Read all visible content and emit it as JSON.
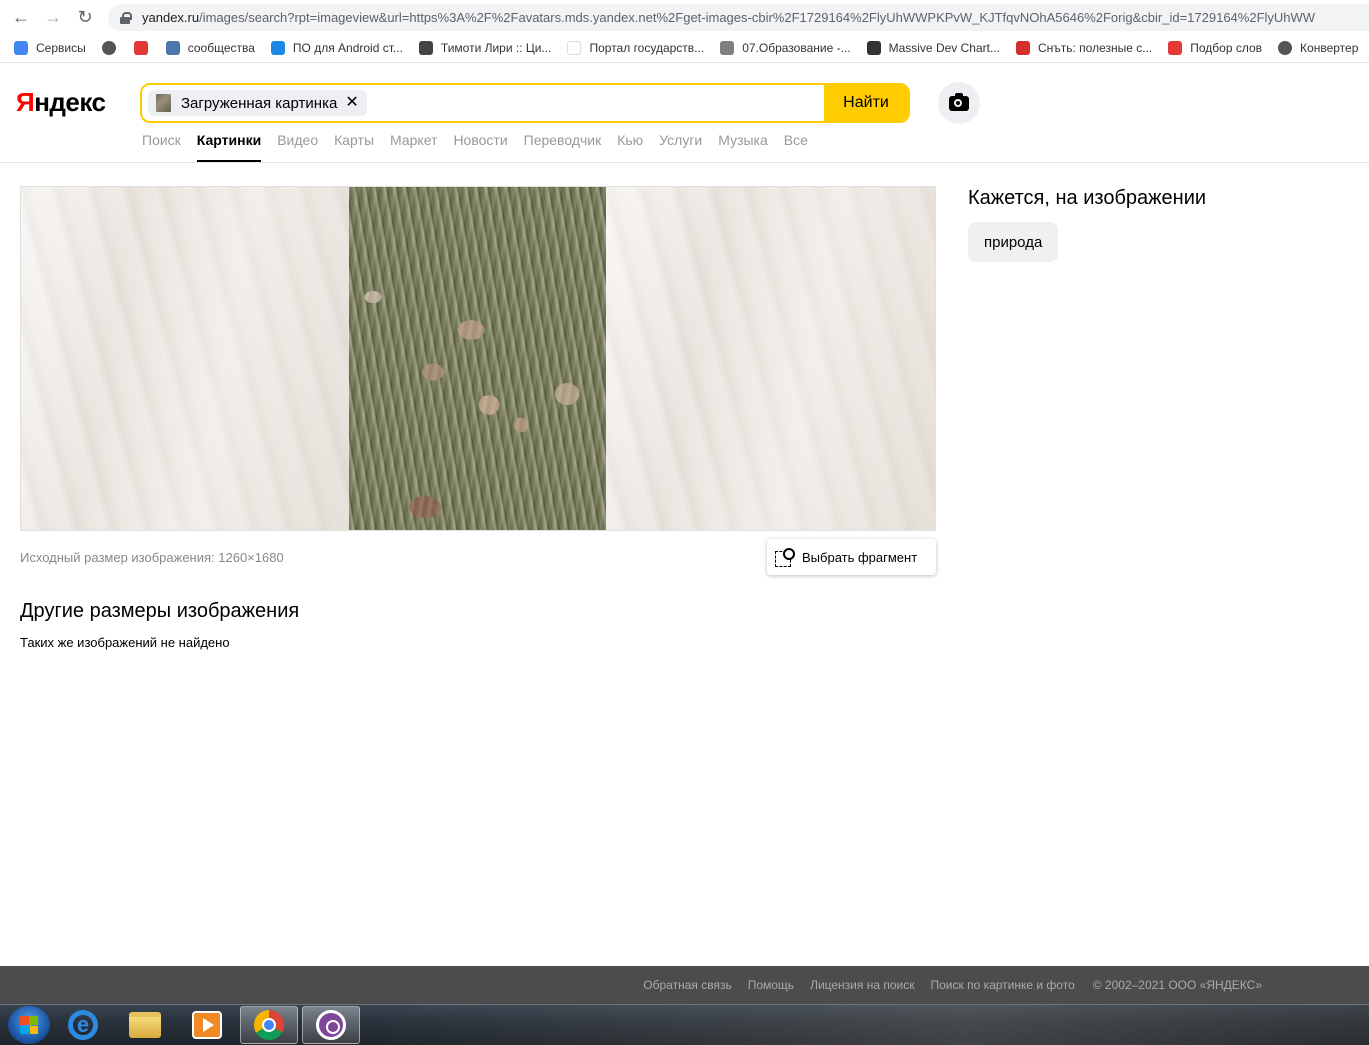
{
  "browser": {
    "url_host": "yandex.ru",
    "url_rest": "/images/search?rpt=imageview&url=https%3A%2F%2Favatars.mds.yandex.net%2Fget-images-cbir%2F1729164%2FlyUhWWPKPvW_KJTfqvNOhA5646%2Forig&cbir_id=1729164%2FlyUhWW",
    "bookmarks": [
      {
        "label": "Сервисы",
        "icon": "apps-grid-icon",
        "color": "#4285f4"
      },
      {
        "label": "",
        "icon": "globe-icon",
        "color": "#555555"
      },
      {
        "label": "",
        "icon": "car-icon",
        "color": "#e53935"
      },
      {
        "label": "сообщества",
        "icon": "vk-icon",
        "color": "#4a76a8"
      },
      {
        "label": "ПО для Android ст...",
        "icon": "butterfly-icon",
        "color": "#1e88e5"
      },
      {
        "label": "Тимоти Лири :: Ци...",
        "icon": "puzzle-icon",
        "color": "#444444"
      },
      {
        "label": "Портал государств...",
        "icon": "blank-icon",
        "color": "#ffffff"
      },
      {
        "label": "07.Образование -...",
        "icon": "c-icon",
        "color": "#7e7e7e"
      },
      {
        "label": "Massive Dev Chart...",
        "icon": "film-icon",
        "color": "#333333"
      },
      {
        "label": "Снъть: полезные с...",
        "icon": "first-aid-icon",
        "color": "#d32f2f"
      },
      {
        "label": "Подбор слов",
        "icon": "bars-icon",
        "color": "#e53935"
      },
      {
        "label": "Конвертер",
        "icon": "globe-icon",
        "color": "#555555"
      }
    ]
  },
  "header": {
    "logo_first": "Я",
    "logo_rest": "ндекс",
    "search_chip_label": "Загруженная картинка",
    "chip_close": "✕",
    "find_button": "Найти",
    "services": [
      {
        "label": "Поиск",
        "active": false
      },
      {
        "label": "Картинки",
        "active": true
      },
      {
        "label": "Видео",
        "active": false
      },
      {
        "label": "Карты",
        "active": false
      },
      {
        "label": "Маркет",
        "active": false
      },
      {
        "label": "Новости",
        "active": false
      },
      {
        "label": "Переводчик",
        "active": false
      },
      {
        "label": "Кью",
        "active": false
      },
      {
        "label": "Услуги",
        "active": false
      },
      {
        "label": "Музыка",
        "active": false
      },
      {
        "label": "Все",
        "active": false
      }
    ]
  },
  "main": {
    "original_size_text": "Исходный размер изображения: 1260×1680",
    "select_fragment_button": "Выбрать фрагмент",
    "other_sizes_title": "Другие размеры изображения",
    "other_sizes_empty": "Таких же изображений не найдено"
  },
  "sidebar": {
    "title": "Кажется, на изображении",
    "tags": [
      "природа"
    ]
  },
  "footer": {
    "links": [
      "Обратная связь",
      "Помощь",
      "Лицензия на поиск",
      "Поиск по картинке и фото"
    ],
    "copyright": "© 2002–2021  ООО «ЯНДЕКС»"
  },
  "colors": {
    "brand_yellow": "#ffcc00",
    "logo_red": "#ff0000",
    "footer_bg": "#4c4c4c"
  }
}
